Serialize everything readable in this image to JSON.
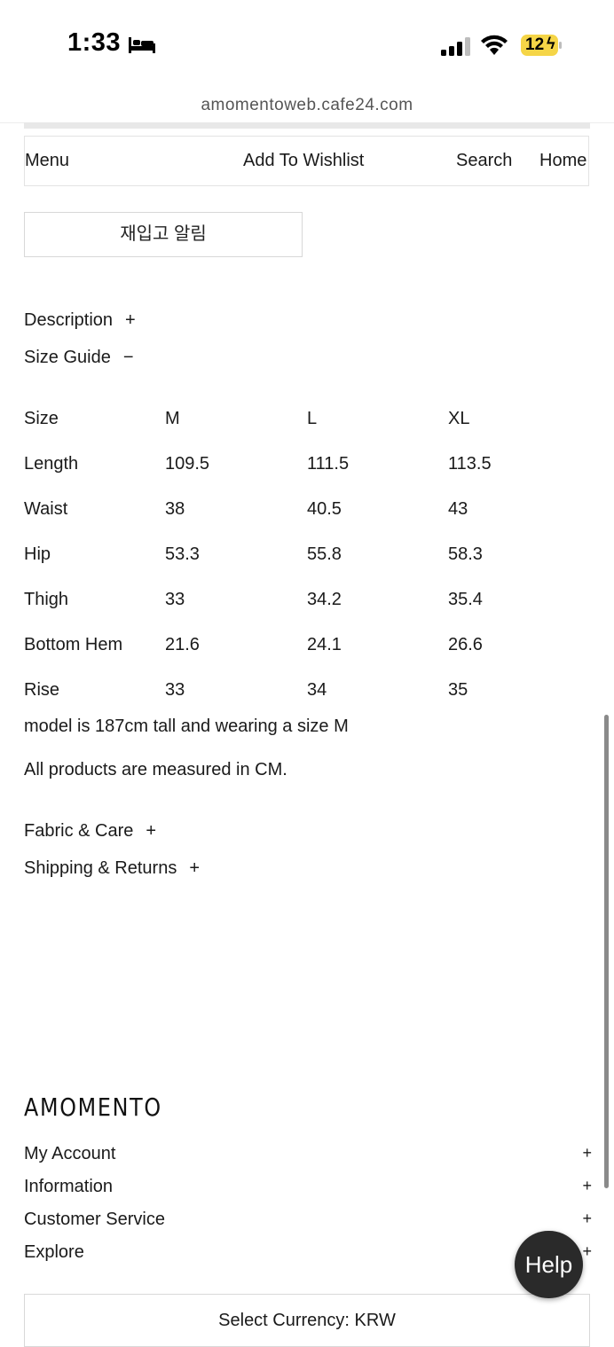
{
  "status_bar": {
    "time": "1:33",
    "battery": "12",
    "icons": [
      "bed-icon",
      "signal-icon",
      "wifi-icon",
      "battery-icon"
    ],
    "battery_color": "#f5d547"
  },
  "browser": {
    "url": "amomentoweb.cafe24.com"
  },
  "nav": {
    "menu": "Menu",
    "wishlist": "Add To Wishlist",
    "search": "Search",
    "home": "Home"
  },
  "restock_button": "재입고 알림",
  "accordions": {
    "description": {
      "label": "Description",
      "sign": "+"
    },
    "size_guide": {
      "label": "Size Guide",
      "sign": "−"
    },
    "fabric": {
      "label": "Fabric & Care",
      "sign": "+"
    },
    "shipping": {
      "label": "Shipping & Returns",
      "sign": "+"
    }
  },
  "size_table": {
    "headers": [
      "Size",
      "M",
      "L",
      "XL"
    ],
    "rows": [
      [
        "Length",
        "109.5",
        "111.5",
        "113.5"
      ],
      [
        "Waist",
        "38",
        "40.5",
        "43"
      ],
      [
        "Hip",
        "53.3",
        "55.8",
        "58.3"
      ],
      [
        "Thigh",
        "33",
        "34.2",
        "35.4"
      ],
      [
        "Bottom Hem",
        "21.6",
        "24.1",
        "26.6"
      ],
      [
        "Rise",
        "33",
        "34",
        "35"
      ]
    ]
  },
  "notes": {
    "model": "model is 187cm tall and wearing a size M",
    "measure": "All products are measured in CM."
  },
  "footer": {
    "brand": "AMOMENTO",
    "items": [
      {
        "label": "My Account",
        "sign": "+"
      },
      {
        "label": "Information",
        "sign": "+"
      },
      {
        "label": "Customer Service",
        "sign": "+"
      },
      {
        "label": "Explore",
        "sign": "+"
      }
    ],
    "currency": "Select Currency: KRW"
  },
  "help_button": "Help"
}
